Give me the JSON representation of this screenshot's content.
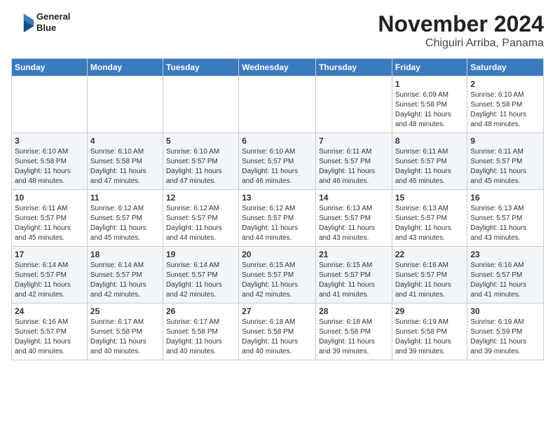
{
  "header": {
    "logo_line1": "General",
    "logo_line2": "Blue",
    "month": "November 2024",
    "location": "Chiguiri Arriba, Panama"
  },
  "days_of_week": [
    "Sunday",
    "Monday",
    "Tuesday",
    "Wednesday",
    "Thursday",
    "Friday",
    "Saturday"
  ],
  "weeks": [
    [
      {
        "day": "",
        "info": ""
      },
      {
        "day": "",
        "info": ""
      },
      {
        "day": "",
        "info": ""
      },
      {
        "day": "",
        "info": ""
      },
      {
        "day": "",
        "info": ""
      },
      {
        "day": "1",
        "info": "Sunrise: 6:09 AM\nSunset: 5:58 PM\nDaylight: 11 hours\nand 48 minutes."
      },
      {
        "day": "2",
        "info": "Sunrise: 6:10 AM\nSunset: 5:58 PM\nDaylight: 11 hours\nand 48 minutes."
      }
    ],
    [
      {
        "day": "3",
        "info": "Sunrise: 6:10 AM\nSunset: 5:58 PM\nDaylight: 11 hours\nand 48 minutes."
      },
      {
        "day": "4",
        "info": "Sunrise: 6:10 AM\nSunset: 5:58 PM\nDaylight: 11 hours\nand 47 minutes."
      },
      {
        "day": "5",
        "info": "Sunrise: 6:10 AM\nSunset: 5:57 PM\nDaylight: 11 hours\nand 47 minutes."
      },
      {
        "day": "6",
        "info": "Sunrise: 6:10 AM\nSunset: 5:57 PM\nDaylight: 11 hours\nand 46 minutes."
      },
      {
        "day": "7",
        "info": "Sunrise: 6:11 AM\nSunset: 5:57 PM\nDaylight: 11 hours\nand 46 minutes."
      },
      {
        "day": "8",
        "info": "Sunrise: 6:11 AM\nSunset: 5:57 PM\nDaylight: 11 hours\nand 46 minutes."
      },
      {
        "day": "9",
        "info": "Sunrise: 6:11 AM\nSunset: 5:57 PM\nDaylight: 11 hours\nand 45 minutes."
      }
    ],
    [
      {
        "day": "10",
        "info": "Sunrise: 6:11 AM\nSunset: 5:57 PM\nDaylight: 11 hours\nand 45 minutes."
      },
      {
        "day": "11",
        "info": "Sunrise: 6:12 AM\nSunset: 5:57 PM\nDaylight: 11 hours\nand 45 minutes."
      },
      {
        "day": "12",
        "info": "Sunrise: 6:12 AM\nSunset: 5:57 PM\nDaylight: 11 hours\nand 44 minutes."
      },
      {
        "day": "13",
        "info": "Sunrise: 6:12 AM\nSunset: 5:57 PM\nDaylight: 11 hours\nand 44 minutes."
      },
      {
        "day": "14",
        "info": "Sunrise: 6:13 AM\nSunset: 5:57 PM\nDaylight: 11 hours\nand 43 minutes."
      },
      {
        "day": "15",
        "info": "Sunrise: 6:13 AM\nSunset: 5:57 PM\nDaylight: 11 hours\nand 43 minutes."
      },
      {
        "day": "16",
        "info": "Sunrise: 6:13 AM\nSunset: 5:57 PM\nDaylight: 11 hours\nand 43 minutes."
      }
    ],
    [
      {
        "day": "17",
        "info": "Sunrise: 6:14 AM\nSunset: 5:57 PM\nDaylight: 11 hours\nand 42 minutes."
      },
      {
        "day": "18",
        "info": "Sunrise: 6:14 AM\nSunset: 5:57 PM\nDaylight: 11 hours\nand 42 minutes."
      },
      {
        "day": "19",
        "info": "Sunrise: 6:14 AM\nSunset: 5:57 PM\nDaylight: 11 hours\nand 42 minutes."
      },
      {
        "day": "20",
        "info": "Sunrise: 6:15 AM\nSunset: 5:57 PM\nDaylight: 11 hours\nand 42 minutes."
      },
      {
        "day": "21",
        "info": "Sunrise: 6:15 AM\nSunset: 5:57 PM\nDaylight: 11 hours\nand 41 minutes."
      },
      {
        "day": "22",
        "info": "Sunrise: 6:16 AM\nSunset: 5:57 PM\nDaylight: 11 hours\nand 41 minutes."
      },
      {
        "day": "23",
        "info": "Sunrise: 6:16 AM\nSunset: 5:57 PM\nDaylight: 11 hours\nand 41 minutes."
      }
    ],
    [
      {
        "day": "24",
        "info": "Sunrise: 6:16 AM\nSunset: 5:57 PM\nDaylight: 11 hours\nand 40 minutes."
      },
      {
        "day": "25",
        "info": "Sunrise: 6:17 AM\nSunset: 5:58 PM\nDaylight: 11 hours\nand 40 minutes."
      },
      {
        "day": "26",
        "info": "Sunrise: 6:17 AM\nSunset: 5:58 PM\nDaylight: 11 hours\nand 40 minutes."
      },
      {
        "day": "27",
        "info": "Sunrise: 6:18 AM\nSunset: 5:58 PM\nDaylight: 11 hours\nand 40 minutes."
      },
      {
        "day": "28",
        "info": "Sunrise: 6:18 AM\nSunset: 5:58 PM\nDaylight: 11 hours\nand 39 minutes."
      },
      {
        "day": "29",
        "info": "Sunrise: 6:19 AM\nSunset: 5:58 PM\nDaylight: 11 hours\nand 39 minutes."
      },
      {
        "day": "30",
        "info": "Sunrise: 6:19 AM\nSunset: 5:59 PM\nDaylight: 11 hours\nand 39 minutes."
      }
    ]
  ]
}
